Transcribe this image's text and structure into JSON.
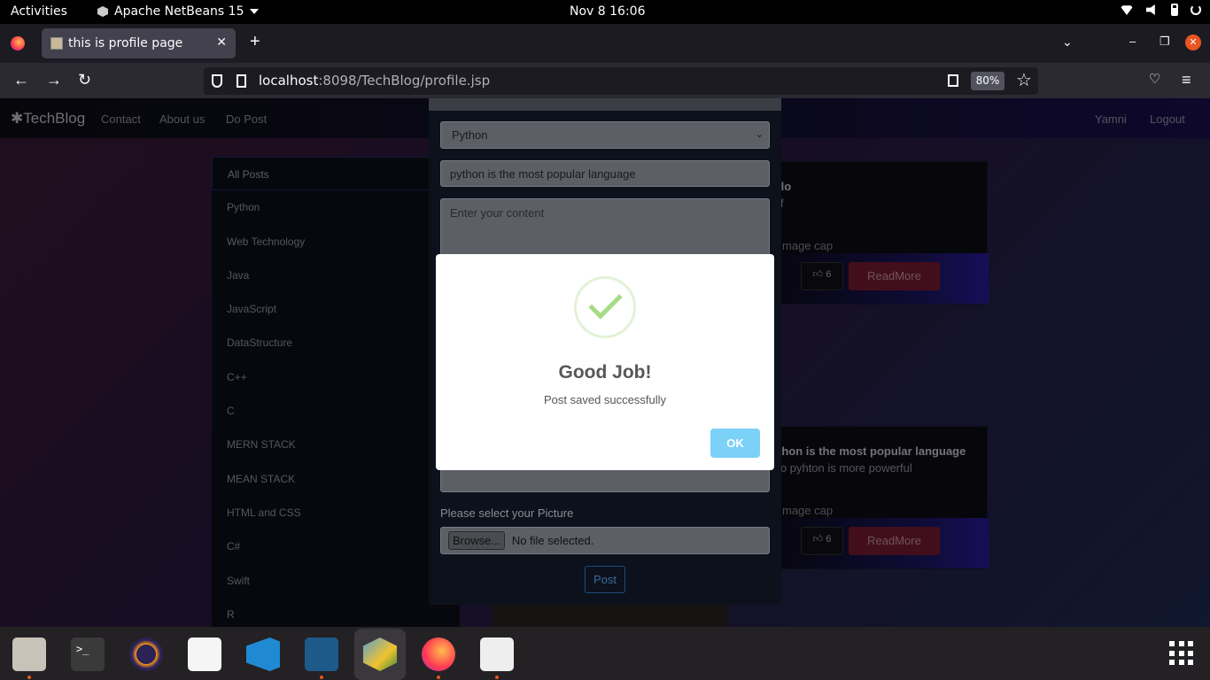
{
  "topbar": {
    "activities": "Activities",
    "app_name": "Apache NetBeans 15",
    "clock": "Nov 8  16:06"
  },
  "browser": {
    "tab_title": "this is profile page",
    "url_host": "localhost",
    "url_rest": ":8098/TechBlog/profile.jsp",
    "zoom": "80%"
  },
  "site": {
    "brand": "✱TechBlog",
    "nav": {
      "contact": "Contact",
      "about": "About us",
      "do_post": "Do Post",
      "user": "Yamni",
      "logout": "Logout"
    },
    "categories": [
      "All Posts",
      "Python",
      "Web Technology",
      "Java",
      "JavaScript",
      "DataStructure",
      "C++",
      "C",
      "MERN STACK",
      "MEAN STACK",
      "HTML and CSS",
      "C#",
      "Swift",
      "R"
    ],
    "cards": [
      {
        "title": "llo",
        "text": "lf",
        "caption": "mage cap",
        "likes": "6",
        "read_more": "ReadMore"
      },
      {
        "title": "thon is the most popular language",
        "text": "lo pyhton is more powerful",
        "caption": "mage cap",
        "likes": "6",
        "read_more": "ReadMore"
      }
    ]
  },
  "post_modal": {
    "category_selected": "Python",
    "title_value": "python is the most popular language",
    "content_placeholder": "Enter your content",
    "picture_label": "Please select your Picture",
    "browse_label": "Browse...",
    "file_status": "No file selected.",
    "post_button": "Post"
  },
  "alert": {
    "title": "Good Job!",
    "message": "Post saved successfully",
    "ok": "OK"
  }
}
